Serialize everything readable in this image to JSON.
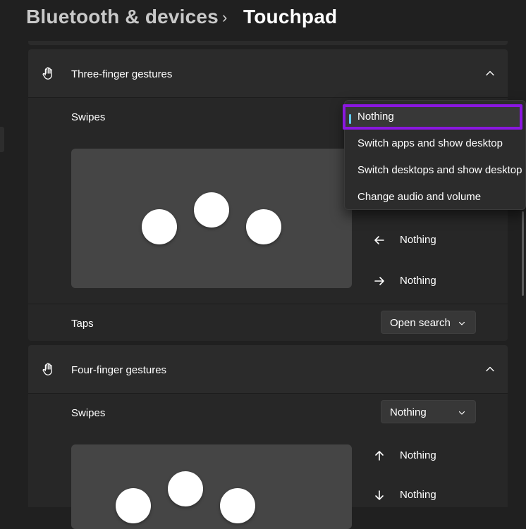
{
  "breadcrumb": {
    "parent": "Bluetooth & devices",
    "separator": "›",
    "current": "Touchpad"
  },
  "three_finger": {
    "title": "Three-finger gestures",
    "swipes_label": "Swipes",
    "swipe_dropdown": {
      "options": [
        "Nothing",
        "Switch apps and show desktop",
        "Switch desktops and show desktop",
        "Change audio and volume"
      ],
      "selected": "Nothing"
    },
    "directions": {
      "left": "Nothing",
      "right": "Nothing"
    },
    "taps_label": "Taps",
    "taps_value": "Open search"
  },
  "four_finger": {
    "title": "Four-finger gestures",
    "swipes_label": "Swipes",
    "swipes_value": "Nothing",
    "directions": {
      "up": "Nothing",
      "down": "Nothing"
    }
  },
  "colors": {
    "accent": "#60cdff",
    "highlight": "#8a17e0",
    "background": "#202020"
  }
}
